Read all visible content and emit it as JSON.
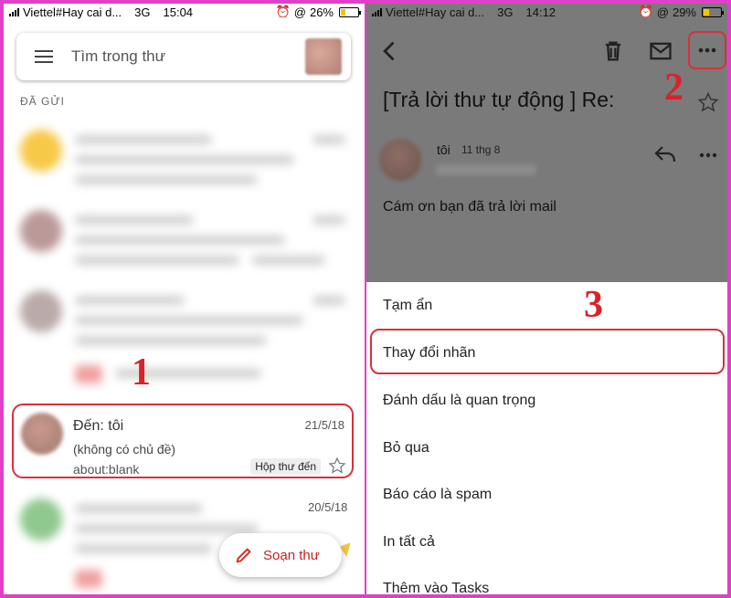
{
  "left_screen": {
    "status_bar": {
      "carrier": "Viettel#Hay cai d...",
      "network": "3G",
      "time": "15:04",
      "battery": "26%",
      "battery_fraction": 0.26
    },
    "search": {
      "placeholder": "Tìm trong thư"
    },
    "section_label": "ĐÃ GỬI",
    "highlighted_mail": {
      "sender": "Đến: tôi",
      "date": "21/5/18",
      "subject": "(không có chủ đề)",
      "preview": "about:blank",
      "label_chip": "Hộp thư đến"
    },
    "next_mail_date": "20/5/18",
    "compose_label": "Soạn thư",
    "step_number": "1"
  },
  "right_screen": {
    "status_bar": {
      "carrier": "Viettel#Hay cai d...",
      "network": "3G",
      "time": "14:12",
      "battery": "29%",
      "battery_fraction": 0.29
    },
    "subject": "[Trả lời thư tự động ] Re:",
    "message": {
      "sender": "tôi",
      "date": "11 thg 8",
      "body": "Cám ơn bạn đã trả lời mail"
    },
    "menu_items": [
      {
        "label": "Tạm ẩn"
      },
      {
        "label": "Thay đổi nhãn"
      },
      {
        "label": "Đánh dấu là quan trọng"
      },
      {
        "label": "Bỏ qua"
      },
      {
        "label": "Báo cáo là spam"
      },
      {
        "label": "In tất cả"
      },
      {
        "label": "Thêm vào Tasks"
      }
    ],
    "step_two": "2",
    "step_three": "3"
  },
  "colors": {
    "accent_red": "#d9303a",
    "border_magenta": "#e040c8",
    "compose_red": "#c5221f"
  }
}
